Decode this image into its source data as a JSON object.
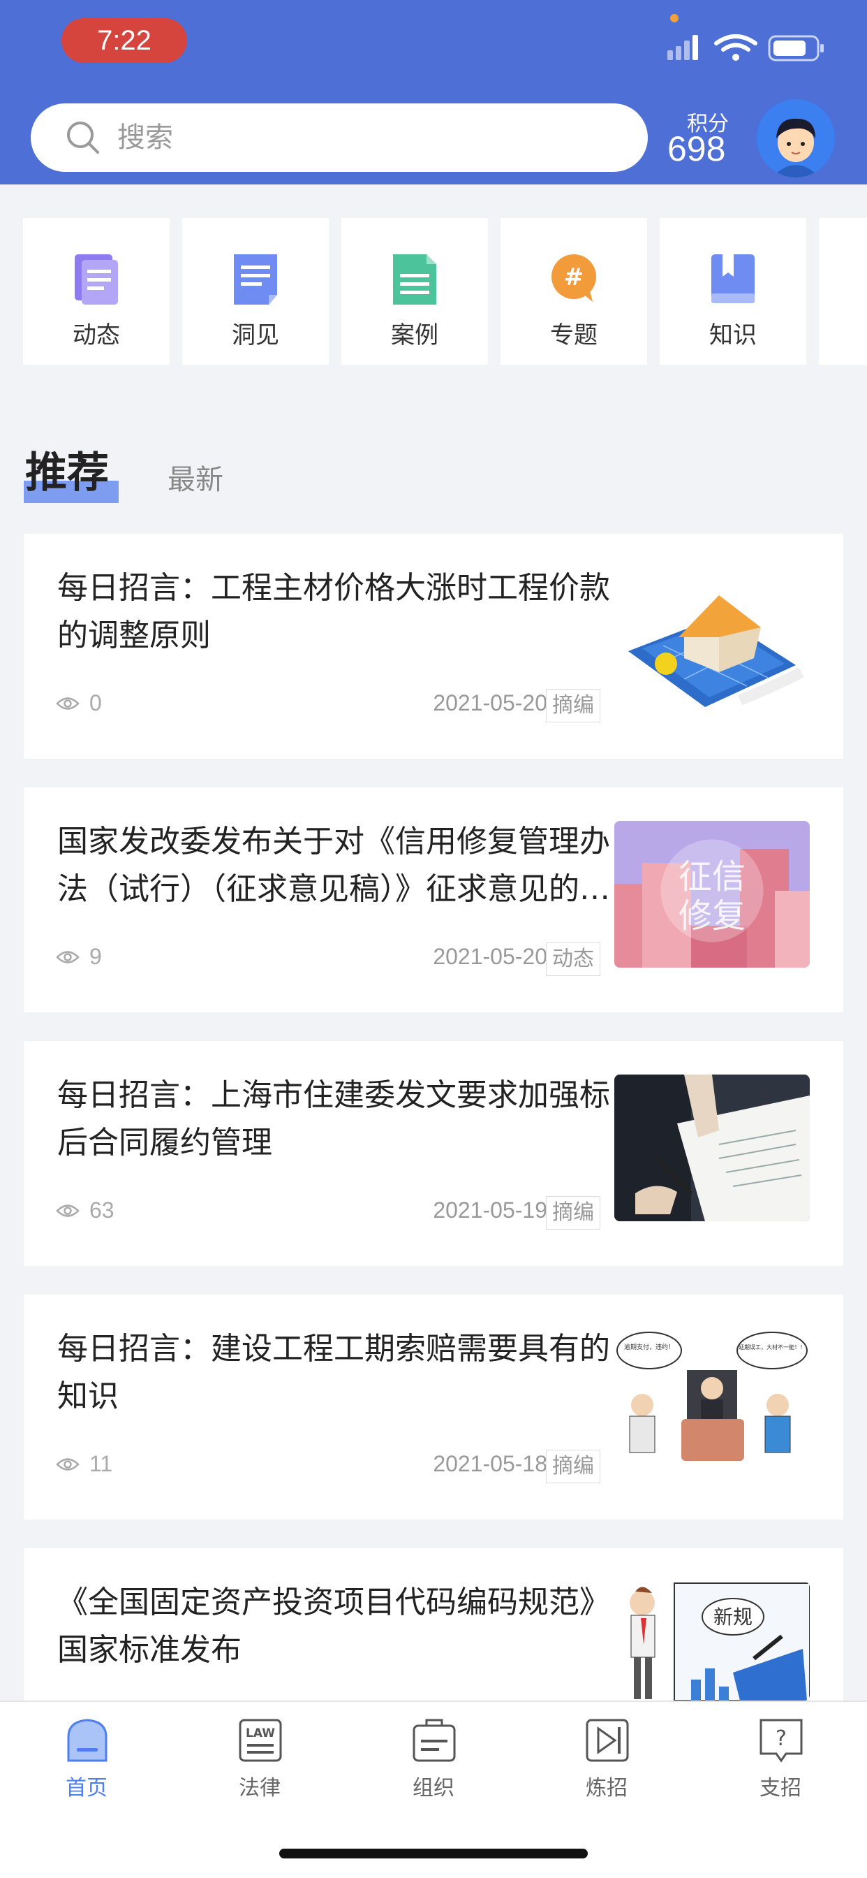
{
  "status_bar": {
    "time": "7:22"
  },
  "header": {
    "search_placeholder": "搜索",
    "points_label": "积分",
    "points_value": "698"
  },
  "categories": [
    {
      "label": "动态",
      "icon": "news-feed-icon",
      "color": "#8e7bf2"
    },
    {
      "label": "洞见",
      "icon": "insight-doc-icon",
      "color": "#6f8cf2"
    },
    {
      "label": "案例",
      "icon": "case-doc-icon",
      "color": "#4cc39a"
    },
    {
      "label": "专题",
      "icon": "topic-hash-icon",
      "color": "#f29b3b"
    },
    {
      "label": "知识",
      "icon": "knowledge-book-icon",
      "color": "#6f8cf2"
    }
  ],
  "tabs": {
    "recommended": "推荐",
    "latest": "最新"
  },
  "articles": [
    {
      "title": "每日招言：工程主材价格大涨时工程价款的调整原则",
      "views": "0",
      "date": "2021-05-20",
      "tag": "摘编"
    },
    {
      "title": "国家发改委发布关于对《信用修复管理办法（试行）（征求意见稿）》征求意见的通知",
      "views": "9",
      "date": "2021-05-20",
      "tag": "动态",
      "thumb_text": [
        "征信",
        "修复"
      ]
    },
    {
      "title": "每日招言：上海市住建委发文要求加强标后合同履约管理",
      "views": "63",
      "date": "2021-05-19",
      "tag": "摘编"
    },
    {
      "title": "每日招言：建设工程工期索赔需要具有的知识",
      "views": "11",
      "date": "2021-05-18",
      "tag": "摘编",
      "thumb_text": [
        "逾期支付，违约！",
        "延期误工，大材不一能！！"
      ]
    },
    {
      "title": "《全国固定资产投资项目代码编码规范》国家标准发布",
      "thumb_text": [
        "新规"
      ]
    }
  ],
  "bottom_nav": [
    {
      "label": "首页",
      "icon": "home-icon",
      "active": true
    },
    {
      "label": "法律",
      "icon": "law-icon",
      "icon_text": "LAW",
      "active": false
    },
    {
      "label": "组织",
      "icon": "organization-icon",
      "active": false
    },
    {
      "label": "炼招",
      "icon": "play-icon",
      "active": false
    },
    {
      "label": "支招",
      "icon": "help-icon",
      "icon_text": "?",
      "active": false
    }
  ],
  "colors": {
    "header": "#4d6fd6",
    "accent": "#4d7ff0",
    "background": "#f2f3f6"
  }
}
